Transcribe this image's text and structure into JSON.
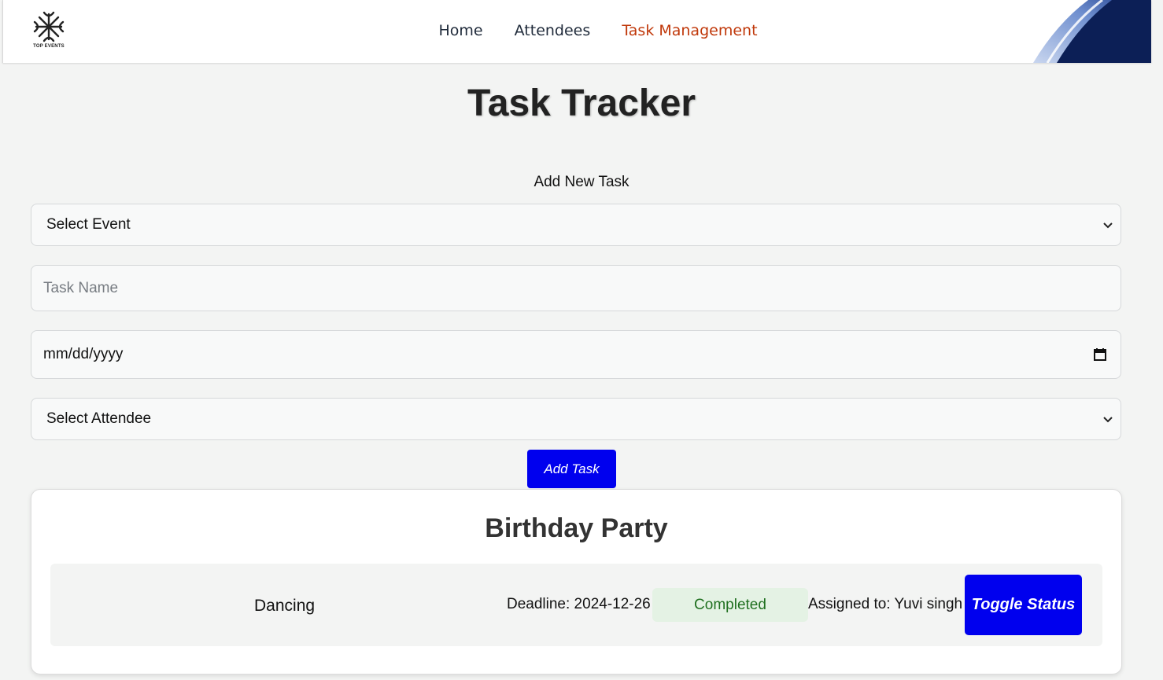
{
  "nav": {
    "logo_text": "TOP EVENTS",
    "links": [
      "Home",
      "Attendees",
      "Task Management"
    ],
    "active": "Task Management"
  },
  "page": {
    "title": "Task Tracker",
    "add_heading": "Add New Task"
  },
  "form": {
    "event_select": "Select Event",
    "task_name_placeholder": "Task Name",
    "date_placeholder": "mm/dd/yyyy",
    "attendee_select": "Select Attendee",
    "add_button": "Add Task"
  },
  "events": [
    {
      "name": "Birthday Party",
      "tasks": [
        {
          "name": "Dancing",
          "deadline": "Deadline: 2024-12-26",
          "status": "Completed",
          "assigned": "Assigned to: Yuvi singh",
          "toggle_label": "Toggle Status"
        }
      ]
    }
  ],
  "colors": {
    "accent_blue": "#0000ee",
    "active_nav": "#c0380a",
    "status_completed_bg": "#e4f2e4",
    "status_completed_text": "#207020"
  },
  "icons": [
    "top-events-logo",
    "chevron-down-icon",
    "calendar-icon"
  ]
}
